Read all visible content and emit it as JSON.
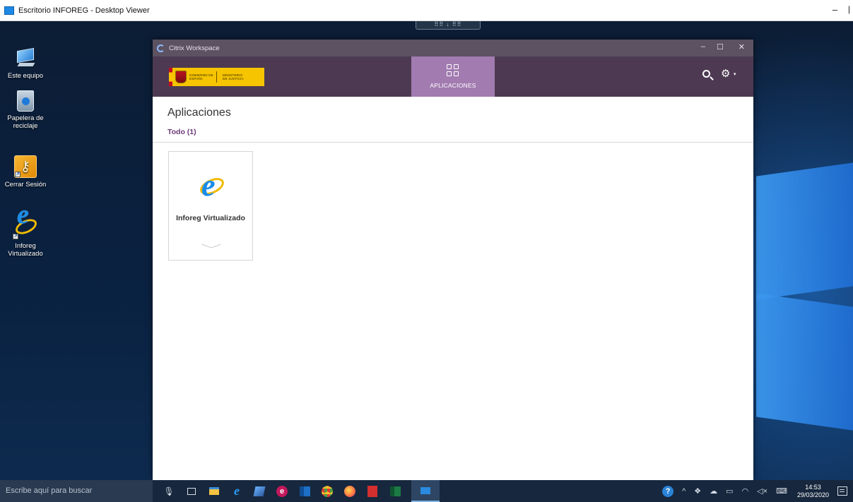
{
  "viewer": {
    "title": "Escritorio INFOREG - Desktop Viewer",
    "min_label": "–",
    "tab_label": "⠿⠿ ↓ ⠿⠿"
  },
  "desktop": {
    "icons": [
      {
        "label": "Este equipo",
        "icon": "computer-icon"
      },
      {
        "label": "Papelera de reciclaje",
        "icon": "recycle-bin-icon"
      },
      {
        "label": "Cerrar Sesión",
        "icon": "key-logout-icon"
      },
      {
        "label": "Inforeg Virtualizado",
        "icon": "internet-explorer-icon"
      }
    ]
  },
  "citrix": {
    "window_title": "Citrix Workspace",
    "min_label": "–",
    "max_label": "☐",
    "close_label": "✕",
    "logo": {
      "gov_text": "GOBIERNO DE ESPAÑA",
      "ministry_text": "MINISTERIO DE JUSTICIA"
    },
    "nav_tab": "APLICACIONES",
    "settings_caret": "▾",
    "page_title": "Aplicaciones",
    "filter_all": "Todo (1)",
    "apps": [
      {
        "name": "Inforeg Virtualizado",
        "icon": "internet-explorer-icon"
      }
    ]
  },
  "taskbar": {
    "search_placeholder": "Escribe aquí para buscar",
    "pinned": [
      "microphone-icon",
      "task-view-icon",
      "file-explorer-icon",
      "internet-explorer-icon",
      "notes-icon",
      "e-app-icon",
      "outlook-icon",
      "chrome-icon",
      "firefox-icon",
      "acrobat-icon",
      "excel-icon",
      "desktop-viewer-icon"
    ],
    "tray": {
      "time": "14:53",
      "date": "29/03/2020"
    }
  },
  "colors": {
    "citrix_header": "#4d3a52",
    "citrix_titlebar": "#5c5261",
    "active_tab": "#a27bb0",
    "filter_accent": "#6b3a78"
  }
}
